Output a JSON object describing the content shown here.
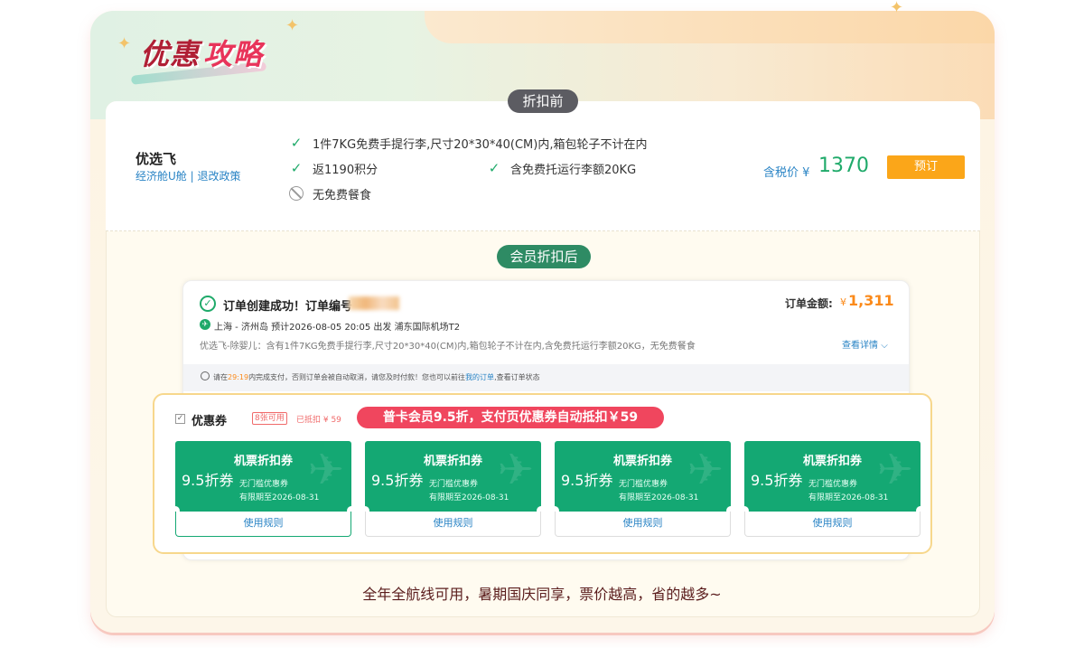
{
  "header": {
    "title_part1": "优惠",
    "title_part2": "攻略"
  },
  "before_section": {
    "label": "折扣前",
    "airline": "优选飞",
    "cabin_link": "经济舱U舱 | 退改政策",
    "features": [
      {
        "icon": "check-icon",
        "text": "1件7KG免费手提行李,尺寸20*30*40(CM)内,箱包轮子不计在内"
      },
      {
        "icon": "check-icon",
        "text": "返1190积分"
      },
      {
        "icon": "check-icon",
        "text": "含免费托运行李额20KG"
      },
      {
        "icon": "no-icon",
        "text": "无免费餐食"
      }
    ],
    "price_label": "含税价 ¥",
    "price": "1370",
    "book_button": "预订"
  },
  "after_section": {
    "label": "会员折扣后",
    "order": {
      "success_text": "订单创建成功！订单编号",
      "amount_label": "订单金额:",
      "amount_currency": "¥",
      "amount_value": "1,311",
      "route": "上海 - 济州岛   预计2026-08-05 20:05  出发  浦东国际机场T2",
      "detail": "优选飞-除婴儿：含有1件7KG免费手提行李,尺寸20*30*40(CM)内,箱包轮子不计在内,含免费托运行李额20KG，无免费餐食",
      "see_more": "查看详情",
      "notice_a": "请在",
      "notice_time": "29:19",
      "notice_b": "内完成支付，否则订单会被自动取消，请您及时付款！您也可以前往",
      "notice_link": "我的订单",
      "notice_c": ",查看订单状态"
    },
    "coupons": {
      "label": "优惠券",
      "available_badge": "8张可用",
      "deducted": "已抵扣 ¥ 59",
      "promo": "普卡会员9.5折，支付页优惠券自动抵扣￥59",
      "items": [
        {
          "title": "机票折扣券",
          "discount": "9.5折券",
          "threshold": "无门槛优惠券",
          "expiry": "有限期至2026-08-31",
          "rule": "使用规则"
        },
        {
          "title": "机票折扣券",
          "discount": "9.5折券",
          "threshold": "无门槛优惠券",
          "expiry": "有限期至2026-08-31",
          "rule": "使用规则"
        },
        {
          "title": "机票折扣券",
          "discount": "9.5折券",
          "threshold": "无门槛优惠券",
          "expiry": "有限期至2026-08-31",
          "rule": "使用规则"
        },
        {
          "title": "机票折扣券",
          "discount": "9.5折券",
          "threshold": "无门槛优惠券",
          "expiry": "有限期至2026-08-31",
          "rule": "使用规则"
        }
      ]
    }
  },
  "slogan": "全年全航线可用，暑期国庆同享，票价越高，省的越多~",
  "colors": {
    "green": "#14a873",
    "orange": "#fba619",
    "red": "#f0465e",
    "blue": "#2a84c5",
    "title_red": "#b01f35"
  }
}
